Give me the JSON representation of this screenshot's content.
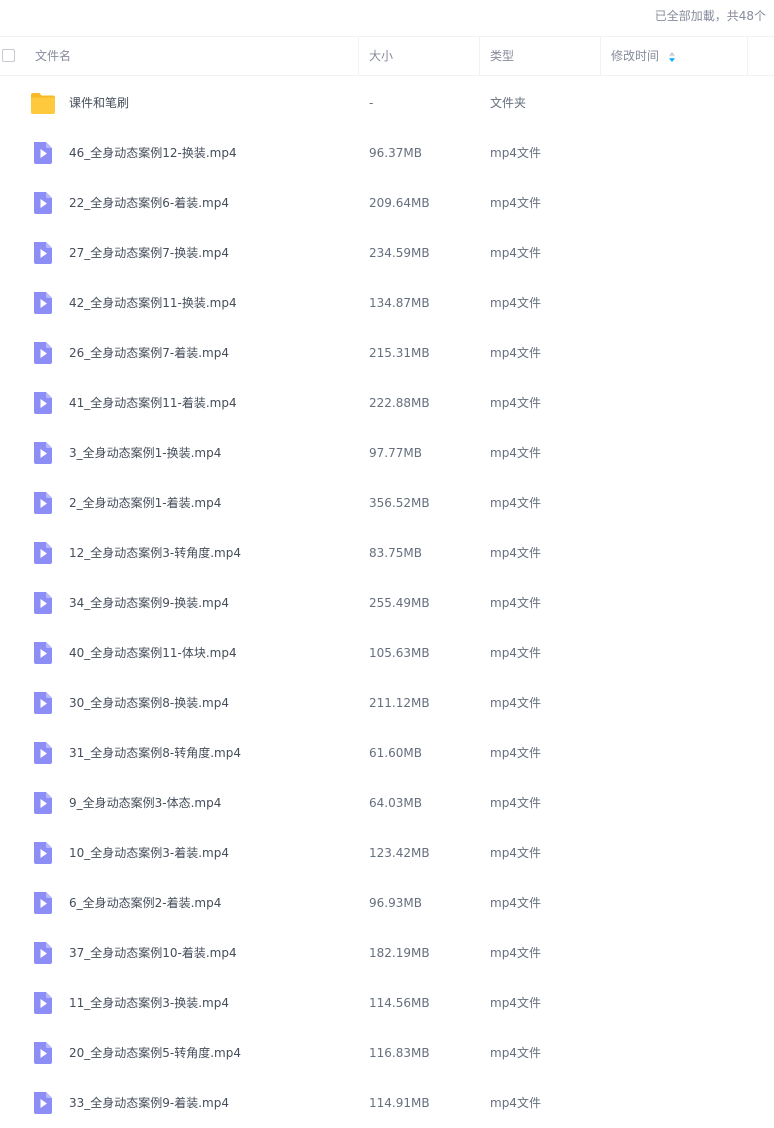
{
  "status": "已全部加載，共48个",
  "header": {
    "name": "文件名",
    "size": "大小",
    "type": "类型",
    "modified": "修改时间"
  },
  "colors": {
    "folder": "#ffc93e",
    "video": "#8c8df5",
    "header_text": "#878c9c",
    "row_text": "#454d5a",
    "sort_arrow_active": "#06a7ff"
  },
  "files": [
    {
      "name": "课件和笔刷",
      "size": "-",
      "type": "文件夹",
      "icon": "folder-icon"
    },
    {
      "name": "46_全身动态案例12-换装.mp4",
      "size": "96.37MB",
      "type": "mp4文件",
      "icon": "video-file-icon"
    },
    {
      "name": "22_全身动态案例6-着装.mp4",
      "size": "209.64MB",
      "type": "mp4文件",
      "icon": "video-file-icon"
    },
    {
      "name": "27_全身动态案例7-换装.mp4",
      "size": "234.59MB",
      "type": "mp4文件",
      "icon": "video-file-icon"
    },
    {
      "name": "42_全身动态案例11-换装.mp4",
      "size": "134.87MB",
      "type": "mp4文件",
      "icon": "video-file-icon"
    },
    {
      "name": "26_全身动态案例7-着装.mp4",
      "size": "215.31MB",
      "type": "mp4文件",
      "icon": "video-file-icon"
    },
    {
      "name": "41_全身动态案例11-着装.mp4",
      "size": "222.88MB",
      "type": "mp4文件",
      "icon": "video-file-icon"
    },
    {
      "name": "3_全身动态案例1-换装.mp4",
      "size": "97.77MB",
      "type": "mp4文件",
      "icon": "video-file-icon"
    },
    {
      "name": "2_全身动态案例1-着装.mp4",
      "size": "356.52MB",
      "type": "mp4文件",
      "icon": "video-file-icon"
    },
    {
      "name": "12_全身动态案例3-转角度.mp4",
      "size": "83.75MB",
      "type": "mp4文件",
      "icon": "video-file-icon"
    },
    {
      "name": "34_全身动态案例9-换装.mp4",
      "size": "255.49MB",
      "type": "mp4文件",
      "icon": "video-file-icon"
    },
    {
      "name": "40_全身动态案例11-体块.mp4",
      "size": "105.63MB",
      "type": "mp4文件",
      "icon": "video-file-icon"
    },
    {
      "name": "30_全身动态案例8-换装.mp4",
      "size": "211.12MB",
      "type": "mp4文件",
      "icon": "video-file-icon"
    },
    {
      "name": "31_全身动态案例8-转角度.mp4",
      "size": "61.60MB",
      "type": "mp4文件",
      "icon": "video-file-icon"
    },
    {
      "name": "9_全身动态案例3-体态.mp4",
      "size": "64.03MB",
      "type": "mp4文件",
      "icon": "video-file-icon"
    },
    {
      "name": "10_全身动态案例3-着装.mp4",
      "size": "123.42MB",
      "type": "mp4文件",
      "icon": "video-file-icon"
    },
    {
      "name": "6_全身动态案例2-着装.mp4",
      "size": "96.93MB",
      "type": "mp4文件",
      "icon": "video-file-icon"
    },
    {
      "name": "37_全身动态案例10-着装.mp4",
      "size": "182.19MB",
      "type": "mp4文件",
      "icon": "video-file-icon"
    },
    {
      "name": "11_全身动态案例3-换装.mp4",
      "size": "114.56MB",
      "type": "mp4文件",
      "icon": "video-file-icon"
    },
    {
      "name": "20_全身动态案例5-转角度.mp4",
      "size": "116.83MB",
      "type": "mp4文件",
      "icon": "video-file-icon"
    },
    {
      "name": "33_全身动态案例9-着装.mp4",
      "size": "114.91MB",
      "type": "mp4文件",
      "icon": "video-file-icon"
    }
  ]
}
